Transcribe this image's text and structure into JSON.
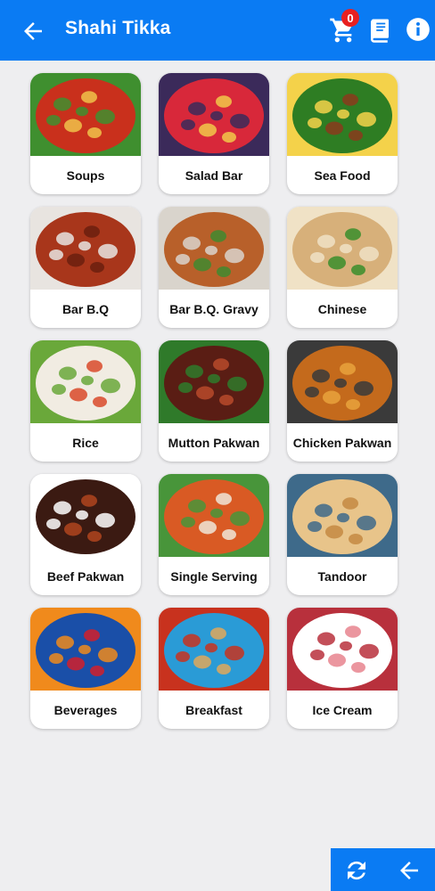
{
  "header": {
    "title": "Shahi Tikka",
    "cart_count": "0",
    "back_icon": "arrow-left-icon",
    "cart_icon": "cart-icon",
    "book_icon": "menu-book-icon",
    "info_icon": "info-icon"
  },
  "categories": [
    {
      "label": "Soups",
      "icon": "soup-bowl-image",
      "colors": [
        "#c9301c",
        "#f0c24a",
        "#3f8f2f"
      ]
    },
    {
      "label": "Salad Bar",
      "icon": "fruit-salad-image",
      "colors": [
        "#d8283a",
        "#f2c84a",
        "#3b2a5a"
      ]
    },
    {
      "label": "Sea Food",
      "icon": "grilled-fish-image",
      "colors": [
        "#2e7d23",
        "#8a3a1c",
        "#f4d24a"
      ]
    },
    {
      "label": "Bar B.Q",
      "icon": "bbq-skewers-image",
      "colors": [
        "#a8361b",
        "#6b1e0e",
        "#e8e4e0"
      ]
    },
    {
      "label": "Bar B.Q. Gravy",
      "icon": "curry-pot-image",
      "colors": [
        "#b8602a",
        "#3f8a2f",
        "#d9d4cc"
      ]
    },
    {
      "label": "Chinese",
      "icon": "stir-fry-image",
      "colors": [
        "#d7b07a",
        "#3a8e2c",
        "#f0e2c6"
      ]
    },
    {
      "label": "Rice",
      "icon": "fried-rice-image",
      "colors": [
        "#f1ece2",
        "#d94a2a",
        "#6aa83a"
      ]
    },
    {
      "label": "Mutton Pakwan",
      "icon": "mutton-dish-image",
      "colors": [
        "#5a1d14",
        "#b84a2a",
        "#2f7a2a"
      ]
    },
    {
      "label": "Chicken Pakwan",
      "icon": "chicken-curry-image",
      "colors": [
        "#c46a1c",
        "#e9a23c",
        "#3a3a3a"
      ]
    },
    {
      "label": "Beef Pakwan",
      "icon": "beef-dish-image",
      "colors": [
        "#3b1a12",
        "#b0451e",
        "#ffffff"
      ]
    },
    {
      "label": "Single Serving",
      "icon": "rice-chicken-plate-image",
      "colors": [
        "#d95a24",
        "#efe6d8",
        "#48953a"
      ]
    },
    {
      "label": "Tandoor",
      "icon": "paratha-bread-image",
      "colors": [
        "#e8c48a",
        "#c48a42",
        "#3e6a8a"
      ]
    },
    {
      "label": "Beverages",
      "icon": "soda-cans-image",
      "colors": [
        "#1a4fa8",
        "#d21e2a",
        "#f08a1c"
      ]
    },
    {
      "label": "Breakfast",
      "icon": "puri-breakfast-image",
      "colors": [
        "#2a9bd6",
        "#e0a85a",
        "#c8321e"
      ]
    },
    {
      "label": "Ice Cream",
      "icon": "ice-cream-image",
      "colors": [
        "#ffffff",
        "#e8848e",
        "#b8303c"
      ]
    }
  ],
  "footer": {
    "refresh_icon": "refresh-icon",
    "back_icon": "arrow-left-icon"
  }
}
